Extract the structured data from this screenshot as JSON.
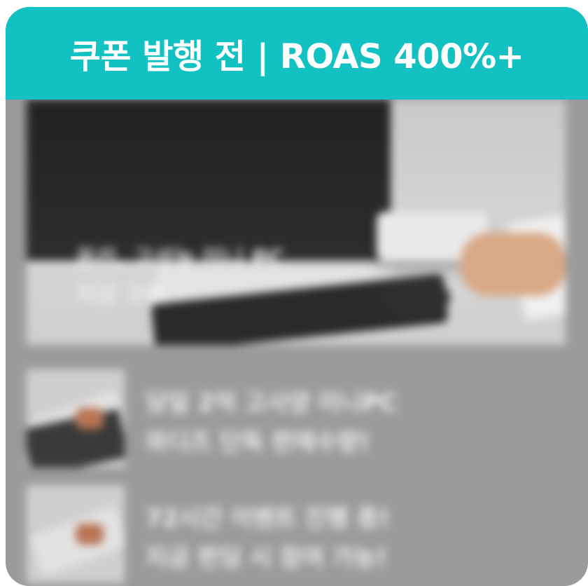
{
  "header": {
    "title": "쿠폰 발행 전 | ROAS 400%+"
  },
  "hero": {
    "overlay_line1": "온리, 고성능 미니 PC",
    "overlay_line2": "지금 구매"
  },
  "list": [
    {
      "line1": "당일 2억 고사양 미니PC",
      "line2": "와디즈 단독 판매수량!"
    },
    {
      "line1": "72시간 이벤트 진행 중!",
      "line2": "지금 펀딩 시 참여 가능!"
    }
  ]
}
